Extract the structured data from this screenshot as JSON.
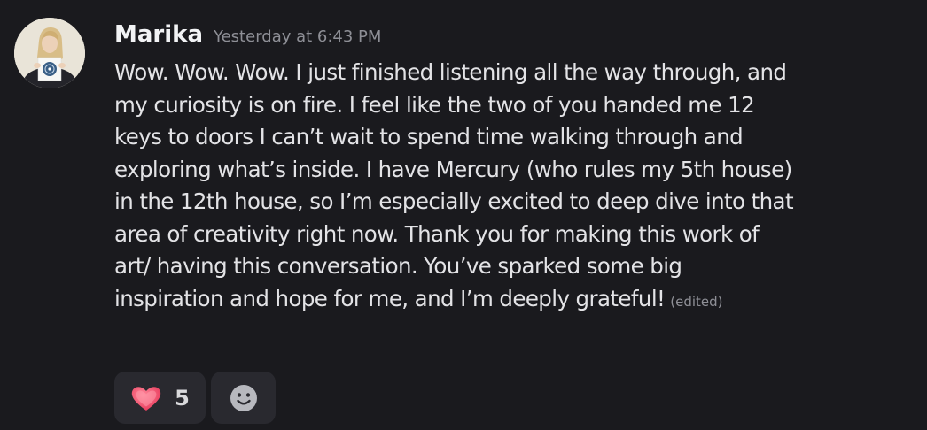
{
  "message": {
    "author": "Marika",
    "timestamp": "Yesterday at 6:43 PM",
    "lines": [
      "Wow. Wow. Wow. I just finished listening all the way through, and",
      "my curiosity is on fire. I feel like the two of you handed me 12",
      "keys to doors I can’t wait to spend time walking through and",
      "exploring what’s inside. I have Mercury (who rules my 5th house)",
      "in the 12th house, so I’m especially excited to deep dive into that",
      "area of creativity right now. Thank you for making this work of",
      "art/ having this conversation. You’ve sparked some big",
      "inspiration and hope for me, and I’m deeply grateful!"
    ],
    "edited_label": "(edited)"
  },
  "reactions": [
    {
      "icon": "heart-icon",
      "count": "5",
      "color": "#f23f5f"
    }
  ],
  "add_reaction_icon": "smiley-face-icon",
  "colors": {
    "background": "#1a1a1e",
    "text": "#e3e3e6",
    "muted": "#8e8f96",
    "reaction_bg": "#29292f"
  }
}
